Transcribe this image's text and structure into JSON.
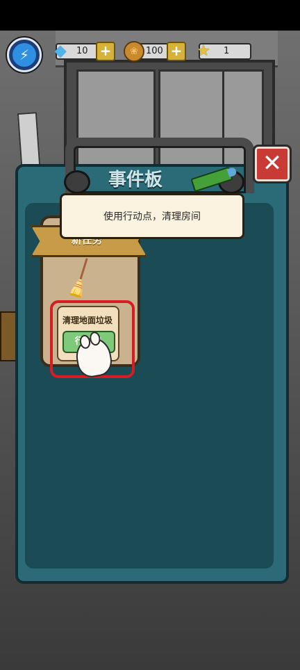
{
  "resources": {
    "diamonds": "10",
    "coins": "100",
    "stars": "1"
  },
  "board": {
    "title": "事件板",
    "tooltip": "使用行动点，清理房间",
    "card": {
      "ribbon": "新任务",
      "task_title": "清理地面垃圾",
      "action_label": "行动-1"
    }
  },
  "icons": {
    "energy": "lightning-icon",
    "diamond": "diamond-icon",
    "coin": "paw-coin-icon",
    "star": "star-icon",
    "close": "close-icon",
    "pencil": "pencil-icon",
    "broom": "broom-icon",
    "hint": "paw-pointer-icon"
  },
  "colors": {
    "close_button": "#c83a33",
    "board": "#2b6a77",
    "action_button": "#7fc97b",
    "highlight": "#d71d24"
  }
}
